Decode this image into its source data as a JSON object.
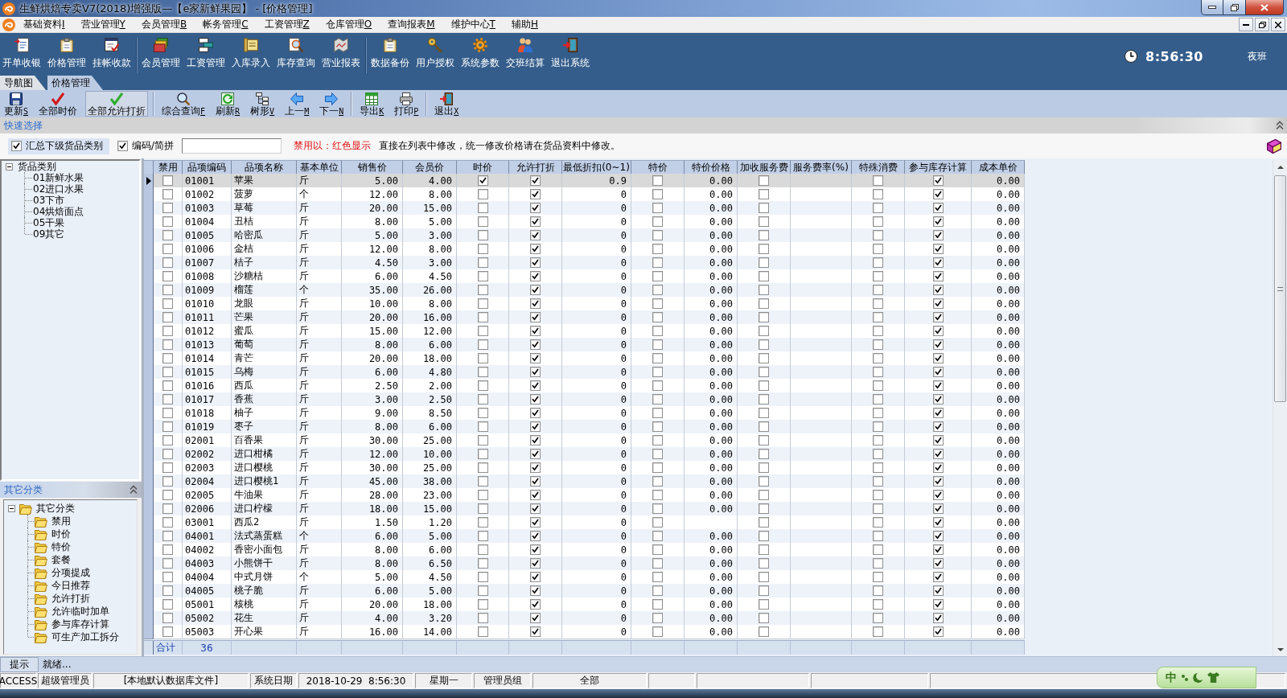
{
  "window": {
    "title": "生鲜烘焙专卖V7(2018)增强版—【e家新鲜果园】 - [价格管理]"
  },
  "menu": [
    {
      "label": "基础资料",
      "accel": "I"
    },
    {
      "label": "营业管理",
      "accel": "Y"
    },
    {
      "label": "会员管理",
      "accel": "B"
    },
    {
      "label": "帐务管理",
      "accel": "C"
    },
    {
      "label": "工资管理",
      "accel": "Z"
    },
    {
      "label": "仓库管理",
      "accel": "O"
    },
    {
      "label": "查询报表",
      "accel": "M"
    },
    {
      "label": "维护中心",
      "accel": "T"
    },
    {
      "label": "辅助",
      "accel": "H"
    }
  ],
  "toolbar": {
    "groups": [
      {
        "buttons": [
          {
            "label": "开单收银"
          },
          {
            "label": "价格管理"
          },
          {
            "label": "挂帐收款"
          }
        ]
      },
      {
        "buttons": [
          {
            "label": "会员管理"
          },
          {
            "label": "工资管理"
          },
          {
            "label": "入库录入"
          },
          {
            "label": "库存查询"
          },
          {
            "label": "营业报表"
          }
        ]
      },
      {
        "buttons": [
          {
            "label": "数据备份"
          },
          {
            "label": "用户授权"
          },
          {
            "label": "系统参数"
          },
          {
            "label": "交班结算"
          },
          {
            "label": "退出系统"
          }
        ]
      }
    ]
  },
  "clock": {
    "time": "8:56:30",
    "shift": "夜班"
  },
  "tabs": [
    {
      "label": "导航图",
      "selected": false
    },
    {
      "label": "价格管理",
      "selected": true
    }
  ],
  "actions": {
    "groups": [
      {
        "buttons": [
          {
            "label": "更新",
            "accel": "S",
            "highlighted": false
          },
          {
            "label": "全部时价",
            "highlighted": false
          },
          {
            "label": "全部允许打折",
            "highlighted": true
          }
        ]
      },
      {
        "buttons": [
          {
            "label": "综合查询",
            "accel": "F",
            "highlighted": false
          },
          {
            "label": "刷新",
            "accel": "R",
            "highlighted": false
          },
          {
            "label": "树形",
            "accel": "V",
            "highlighted": false
          },
          {
            "label": "上一",
            "accel": "M",
            "highlighted": false
          },
          {
            "label": "下一",
            "accel": "N",
            "highlighted": false
          }
        ]
      },
      {
        "buttons": [
          {
            "label": "导出",
            "accel": "K",
            "highlighted": false
          },
          {
            "label": "打印",
            "accel": "P",
            "highlighted": false
          }
        ]
      },
      {
        "buttons": [
          {
            "label": "退出",
            "accel": "X",
            "highlighted": false
          }
        ]
      }
    ]
  },
  "quick_select": {
    "title": "快速选择"
  },
  "filter": {
    "options": [
      {
        "label": "汇总下级货品类别",
        "checked": true,
        "highlighted": true
      },
      {
        "label": "编码/简拼",
        "checked": true,
        "highlighted": false
      }
    ],
    "notes": [
      {
        "kind": "warning",
        "text": "禁用以：红色显示"
      },
      {
        "kind": "info",
        "text": "直接在列表中修改，统一修改价格请在货品资料中修改。"
      }
    ]
  },
  "category_tree": {
    "label": "货品类别",
    "expanded": true,
    "children": [
      {
        "label": "01新鲜水果"
      },
      {
        "label": "02进口水果"
      },
      {
        "label": "03下市"
      },
      {
        "label": "04烘焙面点"
      },
      {
        "label": "05干果"
      },
      {
        "label": "09其它"
      }
    ]
  },
  "other_panel": {
    "title": "其它分类",
    "tree": {
      "label": "其它分类",
      "expanded": true,
      "children": [
        {
          "label": "禁用"
        },
        {
          "label": "时价"
        },
        {
          "label": "特价"
        },
        {
          "label": "套餐"
        },
        {
          "label": "分项提成"
        },
        {
          "label": "今日推荐"
        },
        {
          "label": "允许打折"
        },
        {
          "label": "允许临时加单"
        },
        {
          "label": "参与库存计算"
        },
        {
          "label": "可生产加工拆分"
        }
      ]
    }
  },
  "table": {
    "columns": [
      {
        "label": "禁用",
        "kind": "check"
      },
      {
        "label": "品项编码",
        "kind": "text"
      },
      {
        "label": "品项名称",
        "kind": "text"
      },
      {
        "label": "基本单位",
        "kind": "text"
      },
      {
        "label": "销售价",
        "kind": "number"
      },
      {
        "label": "会员价",
        "kind": "number"
      },
      {
        "label": "时价",
        "kind": "check"
      },
      {
        "label": "允许打折",
        "kind": "check"
      },
      {
        "label": "最低折扣(0~1)",
        "kind": "number"
      },
      {
        "label": "特价",
        "kind": "check"
      },
      {
        "label": "特价价格",
        "kind": "number"
      },
      {
        "label": "加收服务费",
        "kind": "check"
      },
      {
        "label": "服务费率(%)",
        "kind": "number"
      },
      {
        "label": "特殊消费",
        "kind": "check"
      },
      {
        "label": "参与库存计算",
        "kind": "check"
      },
      {
        "label": "成本单价",
        "kind": "number"
      }
    ],
    "rows": [
      {
        "selected": true,
        "banned": false,
        "code": "01001",
        "name": "苹果",
        "unit": "斤",
        "sale_price": "5.00",
        "member_price": "4.00",
        "market_price": true,
        "allow_discount": true,
        "min_discount": "0.9",
        "special": false,
        "special_price": "0.00",
        "service_fee": false,
        "special_consumption": false,
        "stock_calc": true,
        "cost": "0.00"
      },
      {
        "selected": false,
        "banned": false,
        "code": "01002",
        "name": "菠萝",
        "unit": "个",
        "sale_price": "12.00",
        "member_price": "8.00",
        "market_price": false,
        "allow_discount": true,
        "min_discount": "0",
        "special": false,
        "special_price": "0.00",
        "service_fee": false,
        "special_consumption": false,
        "stock_calc": true,
        "cost": "0.00"
      },
      {
        "selected": false,
        "banned": false,
        "code": "01003",
        "name": "草莓",
        "unit": "斤",
        "sale_price": "20.00",
        "member_price": "15.00",
        "market_price": false,
        "allow_discount": true,
        "min_discount": "0",
        "special": false,
        "special_price": "0.00",
        "service_fee": false,
        "special_consumption": false,
        "stock_calc": true,
        "cost": "0.00"
      },
      {
        "selected": false,
        "banned": false,
        "code": "01004",
        "name": "丑桔",
        "unit": "斤",
        "sale_price": "8.00",
        "member_price": "5.00",
        "market_price": false,
        "allow_discount": true,
        "min_discount": "0",
        "special": false,
        "special_price": "0.00",
        "service_fee": false,
        "special_consumption": false,
        "stock_calc": true,
        "cost": "0.00"
      },
      {
        "selected": false,
        "banned": false,
        "code": "01005",
        "name": "哈密瓜",
        "unit": "斤",
        "sale_price": "5.00",
        "member_price": "3.00",
        "market_price": false,
        "allow_discount": true,
        "min_discount": "0",
        "special": false,
        "special_price": "0.00",
        "service_fee": false,
        "special_consumption": false,
        "stock_calc": true,
        "cost": "0.00"
      },
      {
        "selected": false,
        "banned": false,
        "code": "01006",
        "name": "金桔",
        "unit": "斤",
        "sale_price": "12.00",
        "member_price": "8.00",
        "market_price": false,
        "allow_discount": true,
        "min_discount": "0",
        "special": false,
        "special_price": "0.00",
        "service_fee": false,
        "special_consumption": false,
        "stock_calc": true,
        "cost": "0.00"
      },
      {
        "selected": false,
        "banned": false,
        "code": "01007",
        "name": "桔子",
        "unit": "斤",
        "sale_price": "4.50",
        "member_price": "3.00",
        "market_price": false,
        "allow_discount": true,
        "min_discount": "0",
        "special": false,
        "special_price": "0.00",
        "service_fee": false,
        "special_consumption": false,
        "stock_calc": true,
        "cost": "0.00"
      },
      {
        "selected": false,
        "banned": false,
        "code": "01008",
        "name": "沙糖桔",
        "unit": "斤",
        "sale_price": "6.00",
        "member_price": "4.50",
        "market_price": false,
        "allow_discount": true,
        "min_discount": "0",
        "special": false,
        "special_price": "0.00",
        "service_fee": false,
        "special_consumption": false,
        "stock_calc": true,
        "cost": "0.00"
      },
      {
        "selected": false,
        "banned": false,
        "code": "01009",
        "name": "榴莲",
        "unit": "个",
        "sale_price": "35.00",
        "member_price": "26.00",
        "market_price": false,
        "allow_discount": true,
        "min_discount": "0",
        "special": false,
        "special_price": "0.00",
        "service_fee": false,
        "special_consumption": false,
        "stock_calc": true,
        "cost": "0.00"
      },
      {
        "selected": false,
        "banned": false,
        "code": "01010",
        "name": "龙眼",
        "unit": "斤",
        "sale_price": "10.00",
        "member_price": "8.00",
        "market_price": false,
        "allow_discount": true,
        "min_discount": "0",
        "special": false,
        "special_price": "0.00",
        "service_fee": false,
        "special_consumption": false,
        "stock_calc": true,
        "cost": "0.00"
      },
      {
        "selected": false,
        "banned": false,
        "code": "01011",
        "name": "芒果",
        "unit": "斤",
        "sale_price": "20.00",
        "member_price": "16.00",
        "market_price": false,
        "allow_discount": true,
        "min_discount": "0",
        "special": false,
        "special_price": "0.00",
        "service_fee": false,
        "special_consumption": false,
        "stock_calc": true,
        "cost": "0.00"
      },
      {
        "selected": false,
        "banned": false,
        "code": "01012",
        "name": "蜜瓜",
        "unit": "斤",
        "sale_price": "15.00",
        "member_price": "12.00",
        "market_price": false,
        "allow_discount": true,
        "min_discount": "0",
        "special": false,
        "special_price": "0.00",
        "service_fee": false,
        "special_consumption": false,
        "stock_calc": true,
        "cost": "0.00"
      },
      {
        "selected": false,
        "banned": false,
        "code": "01013",
        "name": "葡萄",
        "unit": "斤",
        "sale_price": "8.00",
        "member_price": "6.00",
        "market_price": false,
        "allow_discount": true,
        "min_discount": "0",
        "special": false,
        "special_price": "0.00",
        "service_fee": false,
        "special_consumption": false,
        "stock_calc": true,
        "cost": "0.00"
      },
      {
        "selected": false,
        "banned": false,
        "code": "01014",
        "name": "青芒",
        "unit": "斤",
        "sale_price": "20.00",
        "member_price": "18.00",
        "market_price": false,
        "allow_discount": true,
        "min_discount": "0",
        "special": false,
        "special_price": "0.00",
        "service_fee": false,
        "special_consumption": false,
        "stock_calc": true,
        "cost": "0.00"
      },
      {
        "selected": false,
        "banned": false,
        "code": "01015",
        "name": "乌梅",
        "unit": "斤",
        "sale_price": "6.00",
        "member_price": "4.80",
        "market_price": false,
        "allow_discount": true,
        "min_discount": "0",
        "special": false,
        "special_price": "0.00",
        "service_fee": false,
        "special_consumption": false,
        "stock_calc": true,
        "cost": "0.00"
      },
      {
        "selected": false,
        "banned": false,
        "code": "01016",
        "name": "西瓜",
        "unit": "斤",
        "sale_price": "2.50",
        "member_price": "2.00",
        "market_price": false,
        "allow_discount": true,
        "min_discount": "0",
        "special": false,
        "special_price": "0.00",
        "service_fee": false,
        "special_consumption": false,
        "stock_calc": true,
        "cost": "0.00"
      },
      {
        "selected": false,
        "banned": false,
        "code": "01017",
        "name": "香蕉",
        "unit": "斤",
        "sale_price": "3.00",
        "member_price": "2.50",
        "market_price": false,
        "allow_discount": true,
        "min_discount": "0",
        "special": false,
        "special_price": "0.00",
        "service_fee": false,
        "special_consumption": false,
        "stock_calc": true,
        "cost": "0.00"
      },
      {
        "selected": false,
        "banned": false,
        "code": "01018",
        "name": "柚子",
        "unit": "斤",
        "sale_price": "9.00",
        "member_price": "8.50",
        "market_price": false,
        "allow_discount": true,
        "min_discount": "0",
        "special": false,
        "special_price": "0.00",
        "service_fee": false,
        "special_consumption": false,
        "stock_calc": true,
        "cost": "0.00"
      },
      {
        "selected": false,
        "banned": false,
        "code": "01019",
        "name": "枣子",
        "unit": "斤",
        "sale_price": "8.00",
        "member_price": "6.00",
        "market_price": false,
        "allow_discount": true,
        "min_discount": "0",
        "special": false,
        "special_price": "0.00",
        "service_fee": false,
        "special_consumption": false,
        "stock_calc": true,
        "cost": "0.00"
      },
      {
        "selected": false,
        "banned": false,
        "code": "02001",
        "name": "百香果",
        "unit": "斤",
        "sale_price": "30.00",
        "member_price": "25.00",
        "market_price": false,
        "allow_discount": true,
        "min_discount": "0",
        "special": false,
        "special_price": "0.00",
        "service_fee": false,
        "special_consumption": false,
        "stock_calc": true,
        "cost": "0.00"
      },
      {
        "selected": false,
        "banned": false,
        "code": "02002",
        "name": "进口柑橘",
        "unit": "斤",
        "sale_price": "12.00",
        "member_price": "10.00",
        "market_price": false,
        "allow_discount": true,
        "min_discount": "0",
        "special": false,
        "special_price": "0.00",
        "service_fee": false,
        "special_consumption": false,
        "stock_calc": true,
        "cost": "0.00"
      },
      {
        "selected": false,
        "banned": false,
        "code": "02003",
        "name": "进口樱桃",
        "unit": "斤",
        "sale_price": "30.00",
        "member_price": "25.00",
        "market_price": false,
        "allow_discount": true,
        "min_discount": "0",
        "special": false,
        "special_price": "0.00",
        "service_fee": false,
        "special_consumption": false,
        "stock_calc": true,
        "cost": "0.00"
      },
      {
        "selected": false,
        "banned": false,
        "code": "02004",
        "name": "进口樱桃1",
        "unit": "斤",
        "sale_price": "45.00",
        "member_price": "38.00",
        "market_price": false,
        "allow_discount": true,
        "min_discount": "0",
        "special": false,
        "special_price": "0.00",
        "service_fee": false,
        "special_consumption": false,
        "stock_calc": true,
        "cost": "0.00"
      },
      {
        "selected": false,
        "banned": false,
        "code": "02005",
        "name": "牛油果",
        "unit": "斤",
        "sale_price": "28.00",
        "member_price": "23.00",
        "market_price": false,
        "allow_discount": true,
        "min_discount": "0",
        "special": false,
        "special_price": "0.00",
        "service_fee": false,
        "special_consumption": false,
        "stock_calc": true,
        "cost": "0.00"
      },
      {
        "selected": false,
        "banned": false,
        "code": "02006",
        "name": "进口柠檬",
        "unit": "斤",
        "sale_price": "18.00",
        "member_price": "15.00",
        "market_price": false,
        "allow_discount": true,
        "min_discount": "0",
        "special": false,
        "special_price": "0.00",
        "service_fee": false,
        "special_consumption": false,
        "stock_calc": true,
        "cost": "0.00"
      },
      {
        "selected": false,
        "banned": false,
        "code": "03001",
        "name": "西瓜2",
        "unit": "斤",
        "sale_price": "1.50",
        "member_price": "1.20",
        "market_price": false,
        "allow_discount": true,
        "min_discount": "0",
        "special": false,
        "service_fee": false,
        "special_consumption": false,
        "stock_calc": true,
        "cost": "0.00"
      },
      {
        "selected": false,
        "banned": false,
        "code": "04001",
        "name": "法式蒸蛋糕",
        "unit": "个",
        "sale_price": "6.00",
        "member_price": "5.00",
        "market_price": false,
        "allow_discount": true,
        "min_discount": "0",
        "special": false,
        "special_price": "0.00",
        "service_fee": false,
        "special_consumption": false,
        "stock_calc": true,
        "cost": "0.00"
      },
      {
        "selected": false,
        "banned": false,
        "code": "04002",
        "name": "香密小面包",
        "unit": "斤",
        "sale_price": "8.00",
        "member_price": "6.00",
        "market_price": false,
        "allow_discount": true,
        "min_discount": "0",
        "special": false,
        "special_price": "0.00",
        "service_fee": false,
        "special_consumption": false,
        "stock_calc": true,
        "cost": "0.00"
      },
      {
        "selected": false,
        "banned": false,
        "code": "04003",
        "name": "小熊饼干",
        "unit": "斤",
        "sale_price": "8.00",
        "member_price": "6.50",
        "market_price": false,
        "allow_discount": true,
        "min_discount": "0",
        "special": false,
        "special_price": "0.00",
        "service_fee": false,
        "special_consumption": false,
        "stock_calc": true,
        "cost": "0.00"
      },
      {
        "selected": false,
        "banned": false,
        "code": "04004",
        "name": "中式月饼",
        "unit": "个",
        "sale_price": "5.00",
        "member_price": "4.50",
        "market_price": false,
        "allow_discount": true,
        "min_discount": "0",
        "special": false,
        "special_price": "0.00",
        "service_fee": false,
        "special_consumption": false,
        "stock_calc": true,
        "cost": "0.00"
      },
      {
        "selected": false,
        "banned": false,
        "code": "04005",
        "name": "桃子脆",
        "unit": "斤",
        "sale_price": "6.00",
        "member_price": "5.00",
        "market_price": false,
        "allow_discount": true,
        "min_discount": "0",
        "special": false,
        "special_price": "0.00",
        "service_fee": false,
        "special_consumption": false,
        "stock_calc": true,
        "cost": "0.00"
      },
      {
        "selected": false,
        "banned": false,
        "code": "05001",
        "name": "核桃",
        "unit": "斤",
        "sale_price": "20.00",
        "member_price": "18.00",
        "market_price": false,
        "allow_discount": true,
        "min_discount": "0",
        "special": false,
        "special_price": "0.00",
        "service_fee": false,
        "special_consumption": false,
        "stock_calc": true,
        "cost": "0.00"
      },
      {
        "selected": false,
        "banned": false,
        "code": "05002",
        "name": "花生",
        "unit": "斤",
        "sale_price": "4.00",
        "member_price": "3.20",
        "market_price": false,
        "allow_discount": true,
        "min_discount": "0",
        "special": false,
        "special_price": "0.00",
        "service_fee": false,
        "special_consumption": false,
        "stock_calc": true,
        "cost": "0.00"
      },
      {
        "selected": false,
        "banned": false,
        "code": "05003",
        "name": "开心果",
        "unit": "斤",
        "sale_price": "16.00",
        "member_price": "14.00",
        "market_price": false,
        "allow_discount": true,
        "min_discount": "0",
        "special": false,
        "special_price": "0.00",
        "service_fee": false,
        "special_consumption": false,
        "stock_calc": true,
        "cost": "0.00"
      }
    ],
    "footer": {
      "label": "合计",
      "count": "36"
    }
  },
  "hint_bar": {
    "label": "提示",
    "message": "就绪..."
  },
  "status_bar": {
    "cells": [
      "ACCESS",
      "超级管理员",
      "[本地默认数据库文件]",
      "系统日期",
      "2018-10-29  8:56:30",
      "星期一",
      "管理员组",
      "全部"
    ]
  },
  "ime": {
    "mode": "中"
  }
}
